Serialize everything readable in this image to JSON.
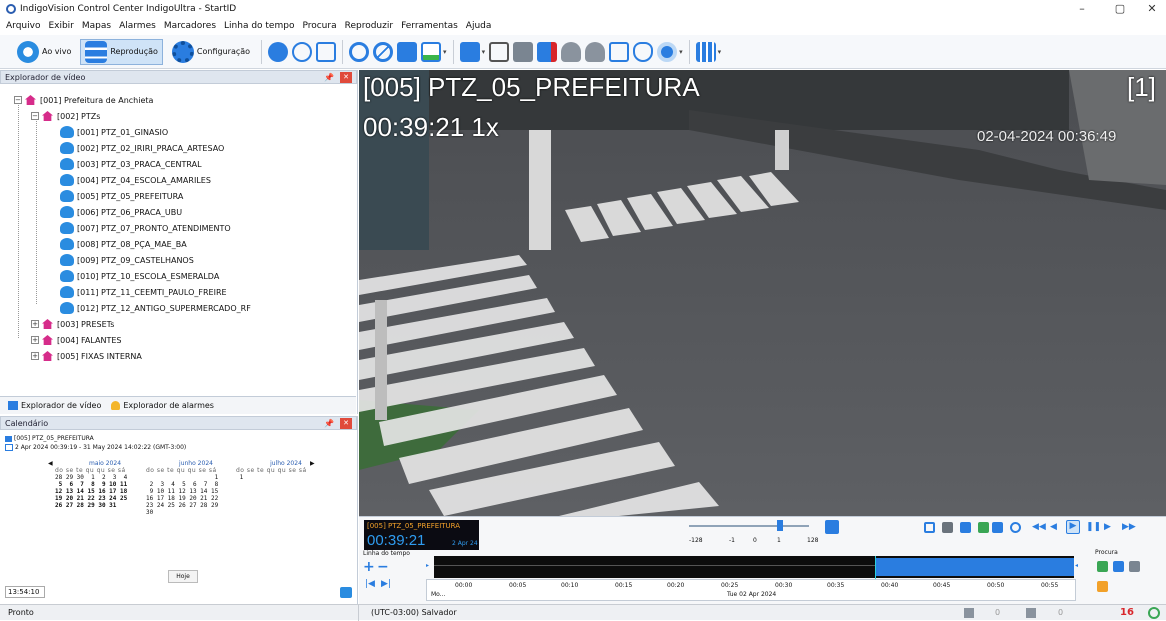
{
  "window": {
    "title": "IndigoVision Control Center IndigoUltra - StartID",
    "minimize": "–",
    "maximize": "▢",
    "close": "✕"
  },
  "menu": [
    "Arquivo",
    "Exibir",
    "Mapas",
    "Alarmes",
    "Marcadores",
    "Linha do tempo",
    "Procura",
    "Reproduzir",
    "Ferramentas",
    "Ajuda"
  ],
  "toolbar": {
    "live_label": "Ao vivo",
    "playback_label": "Reprodução",
    "config_label": "Configuração"
  },
  "explorer": {
    "title": "Explorador de vídeo",
    "root": "[001] Prefeitura de Anchieta",
    "group_ptz": "[002] PTZs",
    "cameras": [
      "[001] PTZ_01_GINASIO",
      "[002] PTZ_02_IRIRI_PRACA_ARTESAO",
      "[003] PTZ_03_PRACA_CENTRAL",
      "[004] PTZ_04_ESCOLA_AMARILES",
      "[005] PTZ_05_PREFEITURA",
      "[006] PTZ_06_PRACA_UBU",
      "[007] PTZ_07_PRONTO_ATENDIMENTO",
      "[008] PTZ_08_PÇA_MAE_BA",
      "[009] PTZ_09_CASTELHANOS",
      "[010] PTZ_10_ESCOLA_ESMERALDA",
      "[011] PTZ_11_CEEMTI_PAULO_FREIRE",
      "[012] PTZ_12_ANTIGO_SUPERMERCADO_RF"
    ],
    "groups": [
      "[003] PRESETs",
      "[004] FALANTES",
      "[005] FIXAS INTERNA"
    ],
    "tab_video": "Explorador de vídeo",
    "tab_alarms": "Explorador de alarmes"
  },
  "calendar": {
    "title": "Calendário",
    "camera": "[005] PTZ_05_PREFEITURA",
    "range": "2 Apr 2024 00:39:19 - 31 May 2024 14:02:22 (GMT-3:00)",
    "prev": "◀",
    "next": "▶",
    "dow": "do se te qu qu se sá",
    "months": [
      {
        "name": "maio 2024",
        "weeks": [
          "28 29 30  1  2  3  4",
          " 5  6  7  8  9 10 11",
          "12 13 14 15 16 17 18",
          "19 20 21 22 23 24 25",
          "26 27 28 29 30 31"
        ]
      },
      {
        "name": "junho 2024",
        "weeks": [
          "                   1",
          " 2  3  4  5  6  7  8",
          " 9 10 11 12 13 14 15",
          "16 17 18 19 20 21 22",
          "23 24 25 26 27 28 29",
          "30"
        ]
      },
      {
        "name": "julho 2024",
        "weeks": [
          " 1"
        ]
      }
    ],
    "today": "Hoje",
    "time": "13:54:10"
  },
  "video": {
    "camera_title": "[005] PTZ_05_PREFEITURA",
    "time_speed": "00:39:21 1x",
    "pane_index": "[1]",
    "osd_datetime": "02-04-2024 00:36:49"
  },
  "playback": {
    "camera": "[005] PTZ_05_PREFEITURA",
    "time": "00:39:21",
    "date": "2 Apr 24",
    "speed_ticks": [
      "-128",
      "-1",
      "0",
      "1",
      "128"
    ],
    "timeline_label": "Linha do tempo",
    "search_label": "Procura",
    "times": [
      "00:00",
      "00:05",
      "00:10",
      "00:15",
      "00:20",
      "00:25",
      "00:30",
      "00:35",
      "00:40",
      "00:45",
      "00:50",
      "00:55"
    ],
    "day_label": "Tue 02 Apr 2024",
    "month_label": "Mo..."
  },
  "status": {
    "left": "Pronto",
    "timezone": "(UTC-03:00) Salvador",
    "count1": "0",
    "count2": "0",
    "alarm_count": "16"
  },
  "colors": {
    "accent": "#2a5db0",
    "timeline_blue": "#2a7de0",
    "alarm_red": "#d8262b"
  }
}
